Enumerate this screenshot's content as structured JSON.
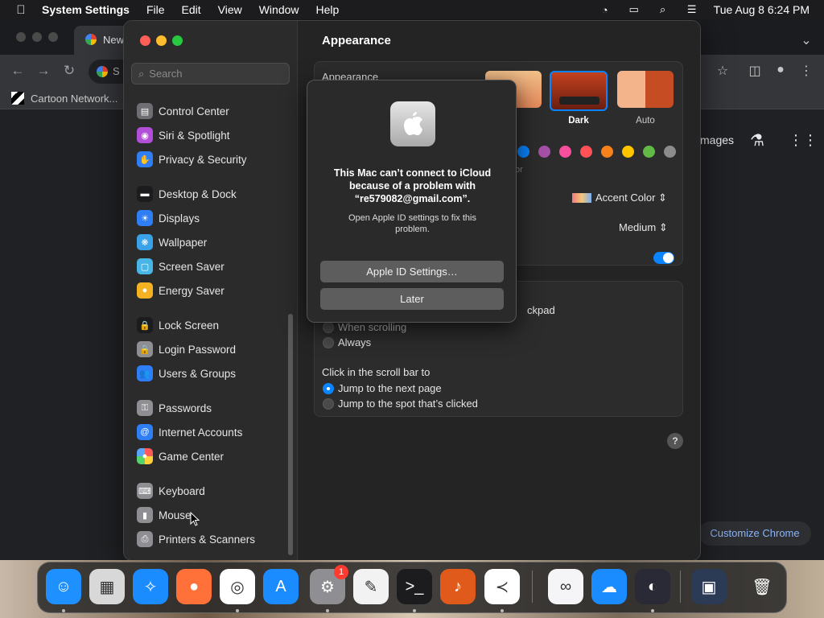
{
  "menubar": {
    "app_name": "System Settings",
    "items": [
      "File",
      "Edit",
      "View",
      "Window",
      "Help"
    ],
    "clock": "Tue Aug 8  6:24 PM"
  },
  "chrome": {
    "tab_title": "New",
    "omnibox_text": "S",
    "bookmark": "Cartoon Network...",
    "images_link": "Images",
    "customize_button": "Customize Chrome"
  },
  "settings": {
    "search_placeholder": "Search",
    "sidebar": [
      {
        "label": "Control Center",
        "icon": "control-center-icon",
        "color": "#6e6e73",
        "glyph": "▤"
      },
      {
        "label": "Siri & Spotlight",
        "icon": "siri-icon",
        "color": "#b14fd8",
        "glyph": "◉"
      },
      {
        "label": "Privacy & Security",
        "icon": "hand-icon",
        "color": "#2f7ef5",
        "glyph": "✋"
      },
      {
        "label": "Desktop & Dock",
        "icon": "dock-icon",
        "color": "#1c1c1e",
        "glyph": "▬"
      },
      {
        "label": "Displays",
        "icon": "sun-icon",
        "color": "#2f7ef5",
        "glyph": "☀"
      },
      {
        "label": "Wallpaper",
        "icon": "wallpaper-icon",
        "color": "#3aa2e8",
        "glyph": "❋"
      },
      {
        "label": "Screen Saver",
        "icon": "screensaver-icon",
        "color": "#47b6e6",
        "glyph": "▢"
      },
      {
        "label": "Energy Saver",
        "icon": "bulb-icon",
        "color": "#f5b324",
        "glyph": "●"
      },
      {
        "label": "Lock Screen",
        "icon": "lock-icon",
        "color": "#1c1c1e",
        "glyph": "🔒"
      },
      {
        "label": "Login Password",
        "icon": "lock-icon",
        "color": "#8e8e93",
        "glyph": "🔒"
      },
      {
        "label": "Users & Groups",
        "icon": "users-icon",
        "color": "#2f7ef5",
        "glyph": "👥"
      },
      {
        "label": "Passwords",
        "icon": "key-icon",
        "color": "#8e8e93",
        "glyph": "⚿"
      },
      {
        "label": "Internet Accounts",
        "icon": "at-icon",
        "color": "#2f7ef5",
        "glyph": "@"
      },
      {
        "label": "Game Center",
        "icon": "gamecenter-icon",
        "color": "#e8e8e8",
        "glyph": "●"
      },
      {
        "label": "Keyboard",
        "icon": "keyboard-icon",
        "color": "#8e8e93",
        "glyph": "⌨"
      },
      {
        "label": "Mouse",
        "icon": "mouse-icon",
        "color": "#8e8e93",
        "glyph": "▮"
      },
      {
        "label": "Printers & Scanners",
        "icon": "printer-icon",
        "color": "#8e8e93",
        "glyph": "⎙"
      }
    ],
    "content": {
      "title": "Appearance",
      "appearance_label": "Appearance",
      "modes": [
        "Dark",
        "Auto"
      ],
      "mode_partial": "nt",
      "accent_color_label": "Accent Color",
      "accent_colors": [
        "#0a84ff",
        "#a550a7",
        "#f74f9e",
        "#ff5257",
        "#f7821b",
        "#ffc600",
        "#62ba46",
        "#8c8c8c"
      ],
      "highlight_partial": "or",
      "sidebar_size_value": "Medium",
      "scroll_partial": "ckpad",
      "scroll_options": [
        "When scrolling",
        "Always"
      ],
      "click_label": "Click in the scroll bar to",
      "click_options": [
        "Jump to the next page",
        "Jump to the spot that’s clicked"
      ]
    }
  },
  "alert": {
    "heading": "This Mac can’t connect to iCloud because of a problem with “re579082@gmail.com”.",
    "body": "Open Apple ID settings to fix this problem.",
    "primary_button": "Apple ID Settings…",
    "secondary_button": "Later"
  },
  "dock": {
    "apps": [
      {
        "name": "finder-icon",
        "bg": "#1e90ff",
        "glyph": "☺"
      },
      {
        "name": "launchpad-icon",
        "bg": "#d8d8d8",
        "glyph": "▦"
      },
      {
        "name": "safari-icon",
        "bg": "#1a8cff",
        "glyph": "✧"
      },
      {
        "name": "firefox-icon",
        "bg": "#ff7139",
        "glyph": "●"
      },
      {
        "name": "chrome-icon",
        "bg": "#ffffff",
        "glyph": "◎"
      },
      {
        "name": "app-store-icon",
        "bg": "#1a8cff",
        "glyph": "A"
      },
      {
        "name": "system-settings-icon",
        "bg": "#8e8e93",
        "glyph": "⚙"
      },
      {
        "name": "textedit-icon",
        "bg": "#f2f2f2",
        "glyph": "✎"
      },
      {
        "name": "terminal-icon",
        "bg": "#1c1c1e",
        "glyph": ">_"
      },
      {
        "name": "garageband-icon",
        "bg": "#e05a1c",
        "glyph": "♪"
      },
      {
        "name": "vscode-icon",
        "bg": "#ffffff",
        "glyph": "≺"
      },
      {
        "name": "visual-studio-icon",
        "bg": "#f5f5f7",
        "glyph": "∞"
      },
      {
        "name": "icloud-icon",
        "bg": "#1a8cff",
        "glyph": "☁"
      },
      {
        "name": "obs-icon",
        "bg": "#2a2a36",
        "glyph": "◐"
      },
      {
        "name": "downloads-icon",
        "bg": "#2b3a55",
        "glyph": "▣"
      },
      {
        "name": "trash-icon",
        "bg": "transparent",
        "glyph": "🗑"
      }
    ],
    "settings_badge": "1"
  }
}
